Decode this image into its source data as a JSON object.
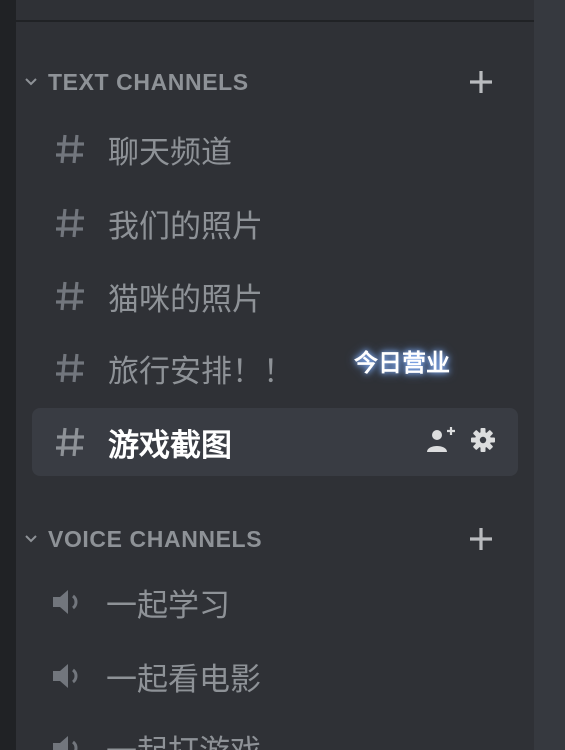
{
  "text_category": {
    "label": "TEXT CHANNELS",
    "collapse_icon": "chevron-down-icon",
    "add_icon": "plus-icon"
  },
  "text_channels": [
    {
      "label": "聊天频道",
      "icon": "hash-icon"
    },
    {
      "label": "我们的照片",
      "icon": "hash-icon"
    },
    {
      "label": "猫咪的照片",
      "icon": "hash-icon"
    },
    {
      "label": "旅行安排！！",
      "icon": "hash-icon"
    },
    {
      "label": "游戏截图",
      "icon": "hash-icon",
      "active": true,
      "tools": [
        "invite-user-icon",
        "gear-icon"
      ]
    }
  ],
  "overlay_caption": "今日营业",
  "voice_category": {
    "label": "VOICE CHANNELS",
    "collapse_icon": "chevron-down-icon",
    "add_icon": "plus-icon"
  },
  "voice_channels": [
    {
      "label": "一起学习",
      "icon": "speaker-icon"
    },
    {
      "label": "一起看电影",
      "icon": "speaker-icon"
    },
    {
      "label": "一起打游戏",
      "icon": "speaker-icon"
    }
  ],
  "colors": {
    "background": "#2f3136",
    "muted_text": "#8e9297",
    "active_bg": "#393c43",
    "active_text": "#ffffff"
  }
}
